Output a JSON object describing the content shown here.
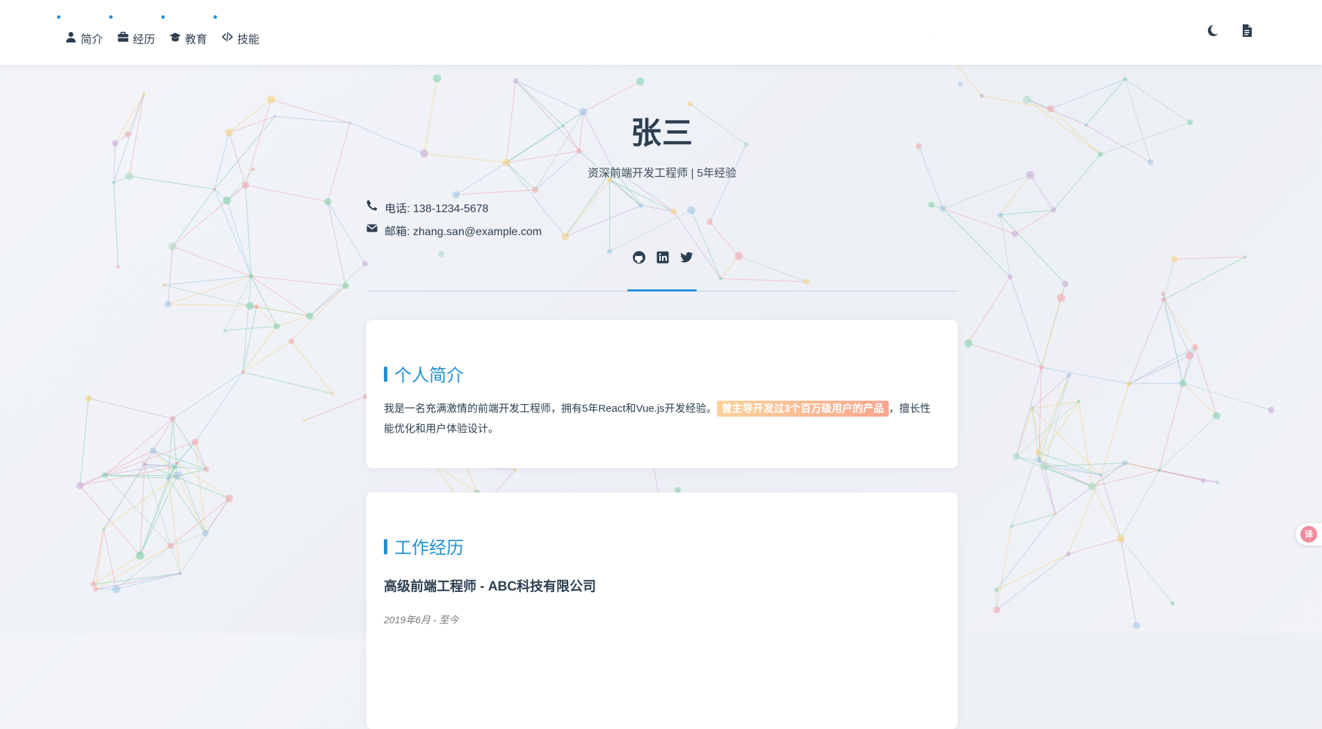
{
  "nav": {
    "items": [
      {
        "label": "简介",
        "icon": "user-icon"
      },
      {
        "label": "经历",
        "icon": "briefcase-icon"
      },
      {
        "label": "教育",
        "icon": "graduation-cap-icon"
      },
      {
        "label": "技能",
        "icon": "code-icon"
      }
    ]
  },
  "toolbar": {
    "icons": [
      "moon-icon",
      "pdf-file-icon"
    ]
  },
  "header": {
    "name": "张三",
    "subtitle": "资深前端开发工程师 | 5年经验"
  },
  "contact": {
    "phone": "电话: 138-1234-5678",
    "email": "邮箱: zhang.san@example.com"
  },
  "social": {
    "icons": [
      "github-icon",
      "linkedin-icon",
      "twitter-icon"
    ]
  },
  "summary": {
    "title": "个人简介",
    "text_before": "我是一名充满激情的前端开发工程师，拥有5年React和Vue.js开发经验。",
    "highlight": "曾主导开发过3个百万级用户的产品",
    "text_after": "，擅长性能优化和用户体验设计。"
  },
  "experience": {
    "title": "工作经历",
    "job_title": "高级前端工程师 - ABC科技有限公司",
    "job_date": "2019年6月 - 至今"
  },
  "translate": {
    "label": "译"
  },
  "colors": {
    "accent": "#1e90d6",
    "text": "#2c3e50",
    "highlight_from": "#fcd29a",
    "highlight_to": "#f9a68f"
  }
}
